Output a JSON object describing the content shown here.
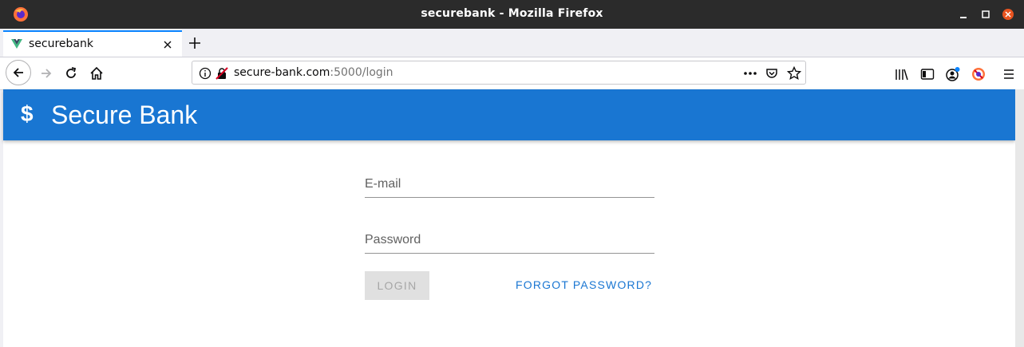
{
  "window": {
    "title": "securebank - Mozilla Firefox"
  },
  "tabs": [
    {
      "label": "securebank"
    }
  ],
  "urlbar": {
    "url_host": "secure-bank.com",
    "url_path": ":5000/login"
  },
  "app": {
    "title": "Secure Bank",
    "logo_symbol": "$",
    "brand_color": "#1976d2"
  },
  "login_form": {
    "email_label": "E-mail",
    "password_label": "Password",
    "login_button": "LOGIN",
    "forgot_link": "FORGOT PASSWORD?"
  },
  "icons": {
    "titlebar": [
      "firefox-logo-icon",
      "minimize-icon",
      "maximize-icon",
      "close-icon"
    ],
    "nav": [
      "back-icon",
      "forward-icon",
      "reload-icon",
      "home-icon"
    ],
    "urlbar": [
      "info-icon",
      "insecure-lock-icon",
      "page-actions-icon",
      "pocket-icon",
      "bookmark-star-icon"
    ],
    "toolbar": [
      "library-icon",
      "sidebar-icon",
      "account-icon",
      "extension-icon",
      "menu-icon"
    ]
  }
}
